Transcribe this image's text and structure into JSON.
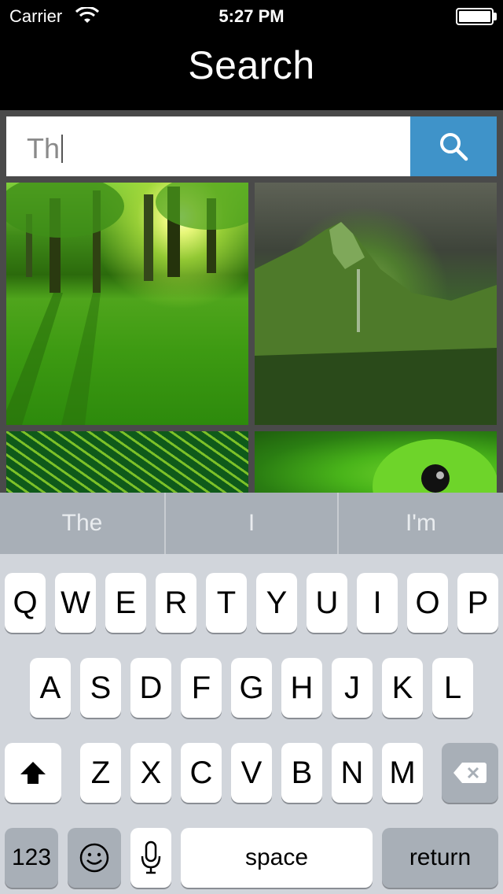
{
  "status_bar": {
    "carrier": "Carrier",
    "time": "5:27 PM",
    "battery_level": 1.0
  },
  "nav": {
    "title": "Search"
  },
  "search": {
    "value": "Th",
    "button_icon": "search-icon",
    "accent_color": "#3f93c9"
  },
  "images": [
    {
      "name": "forest-sunlight-image"
    },
    {
      "name": "green-mountain-image"
    },
    {
      "name": "circuit-board-image"
    },
    {
      "name": "green-frog-image"
    }
  ],
  "keyboard": {
    "suggestions": [
      "The",
      "I",
      "I'm"
    ],
    "row1": [
      "Q",
      "W",
      "E",
      "R",
      "T",
      "Y",
      "U",
      "I",
      "O",
      "P"
    ],
    "row2": [
      "A",
      "S",
      "D",
      "F",
      "G",
      "H",
      "J",
      "K",
      "L"
    ],
    "row3": [
      "Z",
      "X",
      "C",
      "V",
      "B",
      "N",
      "M"
    ],
    "shift_icon": "shift-arrow-icon",
    "delete_icon": "backspace-icon",
    "numbers_label": "123",
    "emoji_icon": "smiley-icon",
    "mic_icon": "microphone-icon",
    "space_label": "space",
    "return_label": "return"
  }
}
